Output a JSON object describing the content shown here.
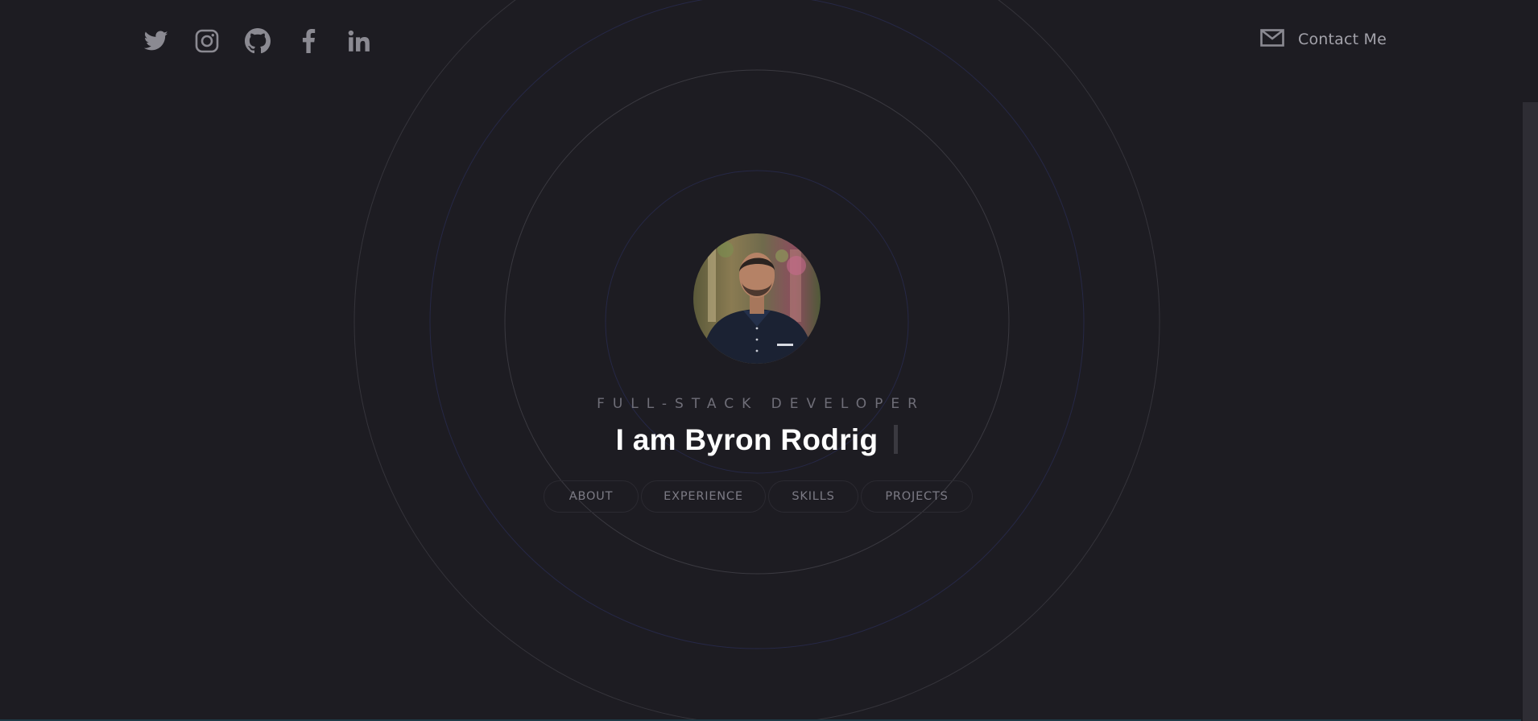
{
  "socials": [
    {
      "name": "twitter-icon"
    },
    {
      "name": "instagram-icon"
    },
    {
      "name": "github-icon"
    },
    {
      "name": "facebook-icon"
    },
    {
      "name": "linkedin-icon"
    }
  ],
  "contact": {
    "icon": "envelope-icon",
    "label": "Contact Me"
  },
  "hero": {
    "subtitle": "FULL-STACK DEVELOPER",
    "headline": "I am Byron Rodrig"
  },
  "nav": {
    "about": "ABOUT",
    "experience": "EXPERIENCE",
    "skills": "SKILLS",
    "projects": "PROJECTS"
  },
  "colors": {
    "background": "#1d1c22",
    "icon": "#8b8a92",
    "ring_gray": "#3a3940",
    "ring_blue": "#272a48"
  }
}
